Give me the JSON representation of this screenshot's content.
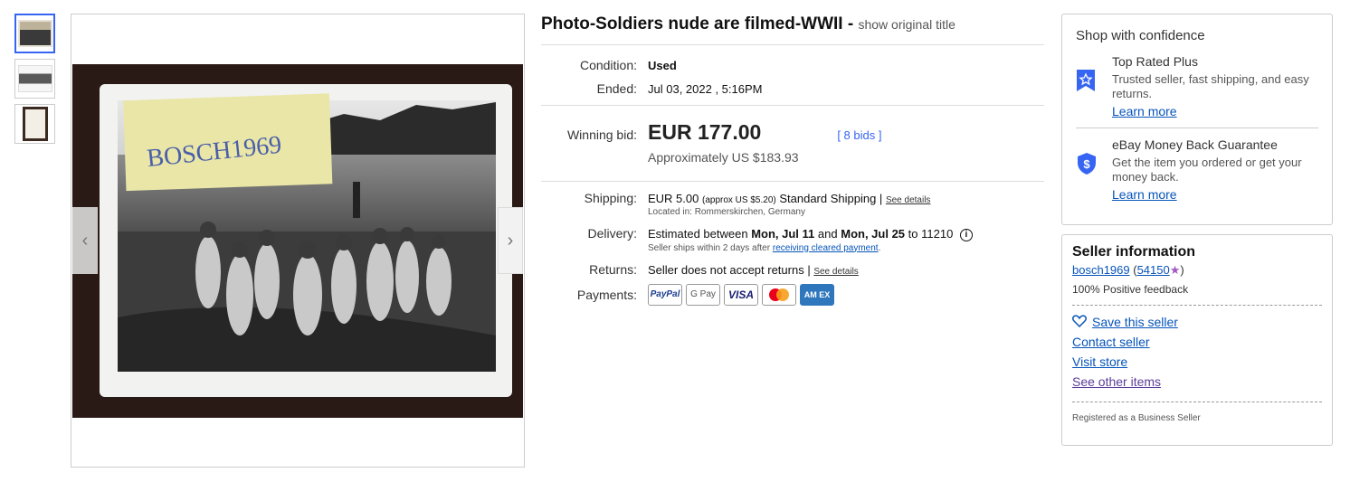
{
  "thumbnails": [
    "thumbnail-1",
    "thumbnail-2",
    "thumbnail-3"
  ],
  "photo_label": "BOSCH1969",
  "listing": {
    "title": "Photo-Soldiers nude are filmed-WWII -",
    "show_original": "show original title",
    "condition_label": "Condition:",
    "condition_value": "Used",
    "ended_label": "Ended:",
    "ended_value": "Jul 03, 2022 , 5:16PM",
    "winning_label": "Winning bid:",
    "winning_amount": "EUR 177.00",
    "bids": "[ 8 bids ]",
    "approx": "Approximately US $183.93",
    "shipping_label": "Shipping:",
    "shipping_price": "EUR 5.00",
    "shipping_approx": "(approx US $5.20)",
    "shipping_method": "Standard Shipping |",
    "see_details": "See details",
    "located": "Located in: Rommerskirchen, Germany",
    "delivery_label": "Delivery:",
    "delivery_pre": "Estimated between",
    "delivery_from": "Mon, Jul 11",
    "delivery_and": "and",
    "delivery_to": "Mon, Jul 25",
    "delivery_zip": "to 11210",
    "ships_within": "Seller ships within 2 days after",
    "cleared_payment": "receiving cleared payment",
    "returns_label": "Returns:",
    "returns_value": "Seller does not accept returns |",
    "returns_details": "See details",
    "payments_label": "Payments:",
    "payment_methods": {
      "paypal": "PayPal",
      "gpay": "G Pay",
      "visa": "VISA",
      "amex": "AM EX"
    }
  },
  "confidence": {
    "title": "Shop with confidence",
    "top_rated_head": "Top Rated Plus",
    "top_rated_desc": "Trusted seller, fast shipping, and easy returns.",
    "learn_more_1": "Learn more",
    "guarantee_head": "eBay Money Back Guarantee",
    "guarantee_desc": "Get the item you ordered or get your money back.",
    "learn_more_2": "Learn more",
    "icon_color": "#3665f3"
  },
  "seller": {
    "title": "Seller information",
    "name": "bosch1969",
    "score": "54150",
    "feedback": "100% Positive feedback",
    "save": "Save this seller",
    "contact": "Contact seller",
    "store": "Visit store",
    "other": "See other items",
    "registered": "Registered as a Business Seller"
  },
  "colors": {
    "link": "#0654ba",
    "accent": "#3665f3"
  }
}
